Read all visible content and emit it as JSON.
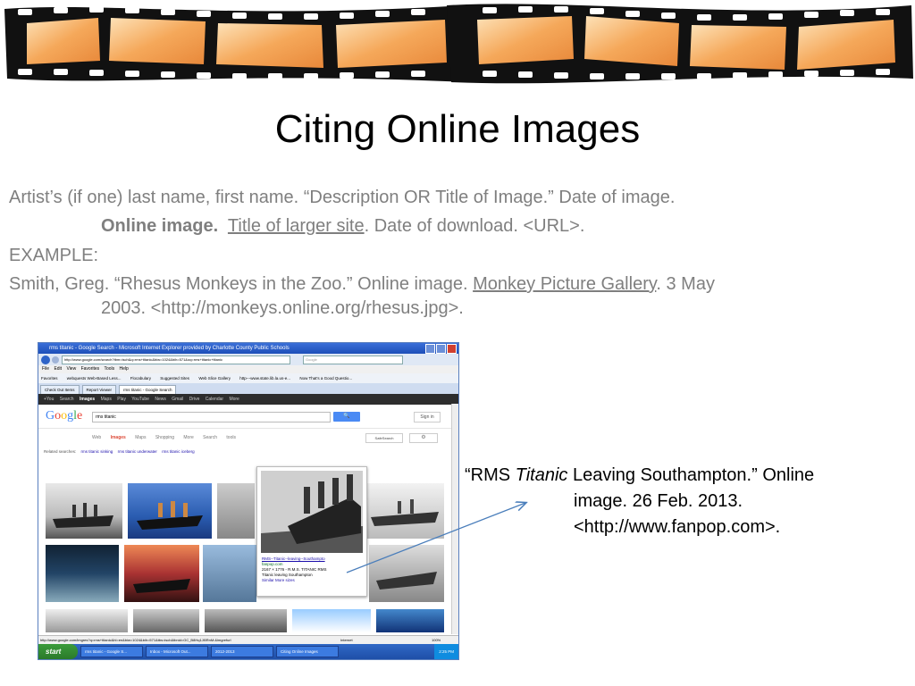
{
  "slide": {
    "title": "Citing Online Images",
    "format_line1": "Artist’s (if one) last name, first name.  “Description OR Title of Image.”  Date of image.",
    "format_line2_bold": "Online image.",
    "format_line2_link": "Title of larger site",
    "format_line2_rest": ".  Date of download.  <URL>.",
    "example_label": "EXAMPLE:",
    "example_line1_pre": "Smith, Greg.  “Rhesus Monkeys in the Zoo.”  Online image.  ",
    "example_line1_link": "Monkey Picture Gallery",
    "example_line1_post": ".  3 May",
    "example_line2": "2003.  <http://monkeys.online.org/rhesus.jpg>.",
    "caption_pre": "“RMS ",
    "caption_italic": "Titanic",
    "caption_post": " Leaving Southampton.”  Online",
    "caption_line2": "image.  26 Feb. 2013.",
    "caption_line3": "<http://www.fanpop.com>."
  },
  "screenshot": {
    "window_title": "rms titanic - Google Search - Microsoft Internet Explorer provided by Charlotte County Public Schools",
    "address": "http://www.google.com/search?tbm=isch&q=rms+titanic&biw=1024&bih=571&oq=rms+titanic+titanic",
    "search_box_placeholder": "Google",
    "menu": "File  Edit  View  Favorites  Tools  Help",
    "favorites": [
      "Favorites",
      "webquests Web-Based Less...",
      "Flocabulary",
      "Suggested Sites",
      "Web Slice Gallery",
      "http---www.state.lib.la.us-e...",
      "Now That's a Good Questio..."
    ],
    "tabs": [
      "Check Out Items",
      "Report Viewer",
      "rms titanic - Google Search"
    ],
    "google_bar": [
      "+You",
      "Search",
      "Images",
      "Maps",
      "Play",
      "YouTube",
      "News",
      "Gmail",
      "Drive",
      "Calendar",
      "More"
    ],
    "google_logo": "Google",
    "query": "rms titanic",
    "search_btn": "🔍",
    "sign_in": "Sign in",
    "result_tabs": [
      "Web",
      "Images",
      "Maps",
      "Shopping",
      "More",
      "Search tools"
    ],
    "safesearch": "SafeSearch",
    "related_label": "Related searches:",
    "related": [
      "rms titanic sinking",
      "rms titanic underwater",
      "rms titanic iceberg"
    ],
    "popup_link": "RMS--Titanic--leaving--Southampto",
    "popup_site": "fanpop.com",
    "popup_size": "2167 × 1776 - R.M.S. TITANIC RMS",
    "popup_desc": "Titanic leaving Southampton",
    "popup_actions": "Similar   More sizes",
    "status_url": "http://www.google.com/imgres?q=rms+titanic&hl=en&biw=1024&bih=571&tbs=isch&tbnid=GC_B8Hq1Ji5RnM:&imgrefurl",
    "status_zone": "Internet",
    "status_zoom": "100%",
    "taskbar_start": "start",
    "taskbar_items": [
      "rms titanic - Google S...",
      "Inbox - Microsoft Out...",
      "2012-2013",
      "Citing Online Images"
    ],
    "clock": "2:25 PM"
  },
  "colors": {
    "film_orange": "#f5a85a",
    "body_gray": "#7f7f7f",
    "arrow_blue": "#4a7ebb",
    "google_red": "#dd4b39"
  }
}
